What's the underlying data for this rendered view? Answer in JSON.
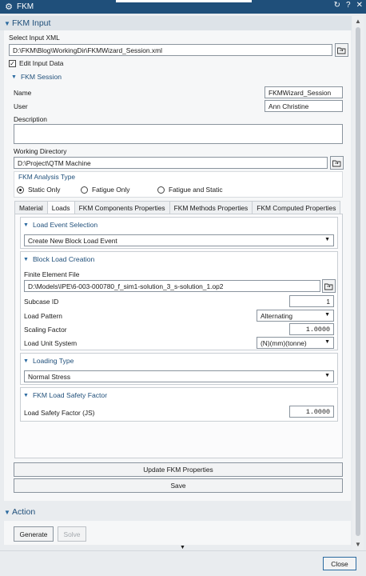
{
  "window": {
    "title": "FKM"
  },
  "fkm_input": {
    "header": "FKM Input",
    "select_xml_label": "Select Input XML",
    "xml_path": "D:\\FKM\\Blog\\WorkingDir\\FKMWizard_Session.xml",
    "edit_input_label": "Edit Input Data",
    "edit_input_checked": true
  },
  "session": {
    "header": "FKM Session",
    "name_label": "Name",
    "name_value": "FKMWizard_Session",
    "user_label": "User",
    "user_value": "Ann Christine",
    "description_label": "Description",
    "description_value": "",
    "working_dir_label": "Working Directory",
    "working_dir_value": "D:\\Project\\QTM Machine"
  },
  "analysis_type": {
    "header": "FKM Analysis Type",
    "options": [
      "Static Only",
      "Fatigue Only",
      "Fatigue and Static"
    ],
    "selected": "Static Only"
  },
  "tabs": [
    "Material",
    "Loads",
    "FKM Components Properties",
    "FKM Methods Properties",
    "FKM Computed Properties"
  ],
  "active_tab": "Loads",
  "load_event": {
    "header": "Load Event Selection",
    "selected": "Create New Block Load Event"
  },
  "block_load": {
    "header": "Block Load Creation",
    "fe_file_label": "Finite Element File",
    "fe_file_value": "D:\\Models\\IPE\\6-003-000780_f_sim1-solution_3_s-solution_1.op2",
    "subcase_label": "Subcase ID",
    "subcase_value": "1",
    "load_pattern_label": "Load Pattern",
    "load_pattern_value": "Alternating",
    "scaling_label": "Scaling Factor",
    "scaling_value": "1.0000",
    "unit_label": "Load Unit System",
    "unit_value": "(N)(mm)(tonne)"
  },
  "loading_type": {
    "header": "Loading Type",
    "selected": "Normal Stress"
  },
  "safety_factor": {
    "header": "FKM Load Safety Factor",
    "label": "Load Safety Factor (JS)",
    "value": "1.0000"
  },
  "buttons": {
    "update": "Update FKM Properties",
    "save": "Save",
    "generate": "Generate",
    "solve": "Solve",
    "close": "Close"
  },
  "action": {
    "header": "Action"
  },
  "icons": {
    "window": "gear-icon",
    "titlebar": [
      "refresh-icon",
      "help-icon",
      "close-icon"
    ],
    "browse": "folder-open-icon"
  },
  "colors": {
    "titlebar": "#1f4f7a",
    "accent": "#1f4f7a"
  }
}
